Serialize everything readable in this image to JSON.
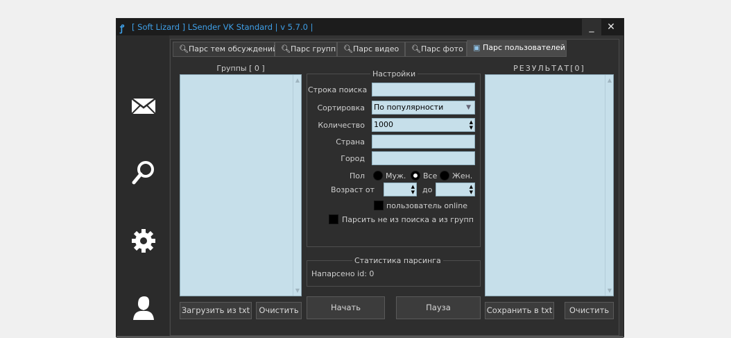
{
  "window": {
    "title": "[ Soft Lizard ] LSender VK Standard | v 5.7.0 |",
    "title_icon": "lizard-icon",
    "minimize_label": "_",
    "close_label": "✕"
  },
  "sidebar": {
    "items": [
      {
        "name": "envelope-icon"
      },
      {
        "name": "magnifier-icon"
      },
      {
        "name": "gear-icon"
      },
      {
        "name": "user-icon"
      }
    ]
  },
  "tabs": [
    {
      "label": "Парс тем обсуждений",
      "icon": "search-icon",
      "active": false
    },
    {
      "label": "Парс групп",
      "icon": "search-icon",
      "active": false
    },
    {
      "label": "Парс видео",
      "icon": "search-icon",
      "active": false
    },
    {
      "label": "Парс фото",
      "icon": "search-icon",
      "active": false
    },
    {
      "label": "Парс пользователей",
      "icon": "users-icon",
      "active": true
    }
  ],
  "groups_panel": {
    "caption": "Группы [ 0 ]",
    "load_button": "Загрузить из txt",
    "clear_button": "Очистить"
  },
  "settings": {
    "title": "Настройки",
    "search_label": "Строка поиска",
    "search_value": "",
    "sort_label": "Сортировка",
    "sort_value": "По популярности",
    "count_label": "Количество",
    "count_value": "1000",
    "country_label": "Страна",
    "country_value": "",
    "city_label": "Город",
    "city_value": "",
    "sex_label": "Пол",
    "sex_options": [
      "Муж.",
      "Все",
      "Жен."
    ],
    "sex_selected": "Все",
    "age_label": "Возраст от",
    "age_from": "",
    "age_to_label": "до",
    "age_to": "",
    "online_label": "пользователь online",
    "online_checked": false,
    "from_groups_label": "Парсить не из поиска а из групп",
    "from_groups_checked": false
  },
  "stats": {
    "title": "Статистика парсинга",
    "parsed_label": "Напарсено id: 0"
  },
  "actions": {
    "start_button": "Начать",
    "pause_button": "Пауза"
  },
  "result_panel": {
    "caption": "РЕЗУЛЬТАТ[0]",
    "save_button": "Сохранить в txt",
    "clear_button": "Очистить"
  },
  "colors": {
    "accent": "#3fa0e8",
    "field_bg": "#c6dfea",
    "window_bg": "#333333"
  }
}
